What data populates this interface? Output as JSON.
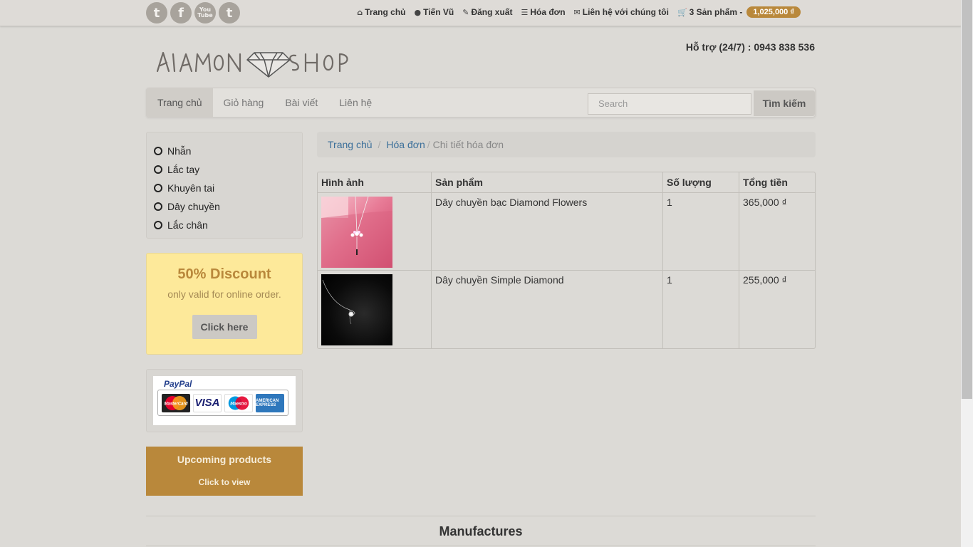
{
  "social": [
    {
      "name": "twitter-icon",
      "glyph": "t"
    },
    {
      "name": "facebook-icon",
      "glyph": "f"
    },
    {
      "name": "youtube-icon",
      "glyph": "You Tube"
    },
    {
      "name": "tumblr-icon",
      "glyph": "t"
    }
  ],
  "toplinks": {
    "home": "Trang chủ",
    "user": "Tiến Vũ",
    "logout": "Đăng xuất",
    "orders": "Hóa đơn",
    "contact": "Liên hệ với chúng tôi",
    "cart": "3 Sản phẩm -",
    "cart_total": "1,025,000 ₫"
  },
  "header": {
    "logo_text": "DIAMON SHOP",
    "support": "Hỗ trợ (24/7) : 0943 838 536"
  },
  "nav": {
    "items": [
      "Trang chủ",
      "Giỏ hàng",
      "Bài viết",
      "Liên hệ"
    ],
    "search_placeholder": "Search",
    "search_button": "Tìm kiếm"
  },
  "categories": [
    "Nhẫn",
    "Lắc tay",
    "Khuyên tai",
    "Dây chuyền",
    "Lắc chân"
  ],
  "promo": {
    "heading": "50% Discount",
    "sub": "only valid for online order.",
    "button": "Click here"
  },
  "payment": {
    "brand": "PayPal",
    "cards": [
      "MasterCard",
      "VISA",
      "Maestro",
      "AMERICAN EXPRESS"
    ]
  },
  "upcoming": {
    "title": "Upcoming products",
    "link": "Click to view"
  },
  "breadcrumb": {
    "home": "Trang chủ",
    "orders": "Hóa đơn",
    "current": "Chi tiết hóa đơn"
  },
  "table": {
    "headers": [
      "Hình ảnh",
      "Sản phẩm",
      "Số lượng",
      "Tổng tiền"
    ],
    "rows": [
      {
        "product": "Dây chuyền bạc Diamond Flowers",
        "qty": "1",
        "total": "365,000 ₫"
      },
      {
        "product": "Dây chuyền Simple Diamond",
        "qty": "1",
        "total": "255,000 ₫"
      }
    ]
  },
  "footer": {
    "manufactures": "Manufactures"
  }
}
